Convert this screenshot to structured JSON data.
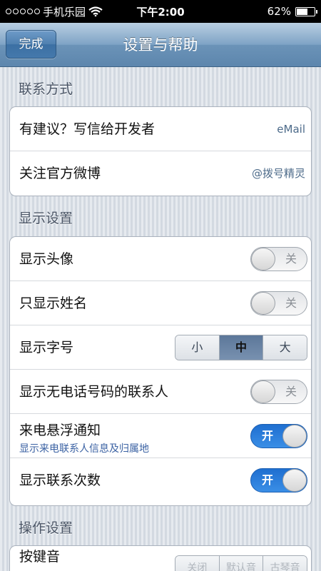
{
  "status_bar": {
    "carrier": "手机乐园",
    "time": "下午2:00",
    "battery": "62%",
    "battery_level": 0.62,
    "icons": [
      "signal-dots-icon",
      "wifi-icon",
      "battery-icon"
    ]
  },
  "nav": {
    "done_label": "完成",
    "title": "设置与帮助"
  },
  "sections": {
    "contact": {
      "title": "联系方式",
      "rows": [
        {
          "label": "有建议？写信给开发者",
          "detail": "eMail"
        },
        {
          "label": "关注官方微博",
          "detail": "@拨号精灵"
        }
      ]
    },
    "display": {
      "title": "显示设置",
      "rows": [
        {
          "label": "显示头像",
          "toggle": "关",
          "state": "off"
        },
        {
          "label": "只显示姓名",
          "toggle": "关",
          "state": "off"
        },
        {
          "label": "显示字号",
          "segments": [
            "小",
            "中",
            "大"
          ],
          "selected": "中"
        },
        {
          "label": "显示无电话号码的联系人",
          "toggle": "关",
          "state": "off"
        },
        {
          "label": "来电悬浮通知",
          "sublabel": "显示来电联系人信息及归属地",
          "toggle": "开",
          "state": "on"
        },
        {
          "label": "显示联系次数",
          "toggle": "开",
          "state": "on"
        }
      ]
    },
    "operation": {
      "title": "操作设置",
      "rows": [
        {
          "label": "按键音",
          "segments": [
            "关闭",
            "默认音",
            "古琴音"
          ]
        }
      ]
    }
  },
  "colors": {
    "nav_blue": "#6b93b8",
    "toggle_on": "#2a7edb",
    "sublabel": "#3b62a3"
  }
}
